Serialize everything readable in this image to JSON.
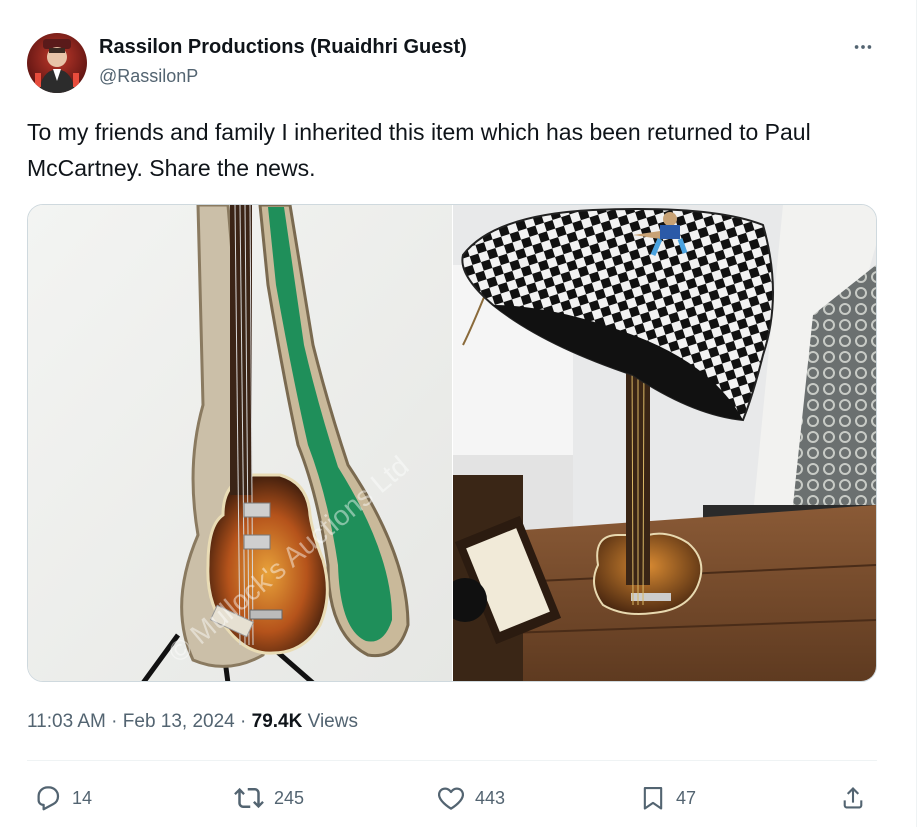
{
  "author": {
    "display_name": "Rassilon Productions (Ruaidhri Guest)",
    "handle": "@RassilonP",
    "avatar_icon": "profile-avatar"
  },
  "more_icon": "ellipsis-icon",
  "tweet": {
    "text": "To my friends and family I inherited this item which has been returned to Paul McCartney. Share the news."
  },
  "media": {
    "watermark": "© Mullock's Auctions Ltd"
  },
  "meta": {
    "time": "11:03 AM",
    "separator": "·",
    "date": "Feb 13, 2024",
    "views_count": "79.4K",
    "views_label": "Views"
  },
  "actions": {
    "reply_count": "14",
    "retweet_count": "245",
    "like_count": "443",
    "bookmark_count": "47"
  },
  "colors": {
    "text_primary": "#0f1419",
    "text_secondary": "#536471",
    "border": "#cfd9de",
    "divider": "#eff3f4"
  }
}
